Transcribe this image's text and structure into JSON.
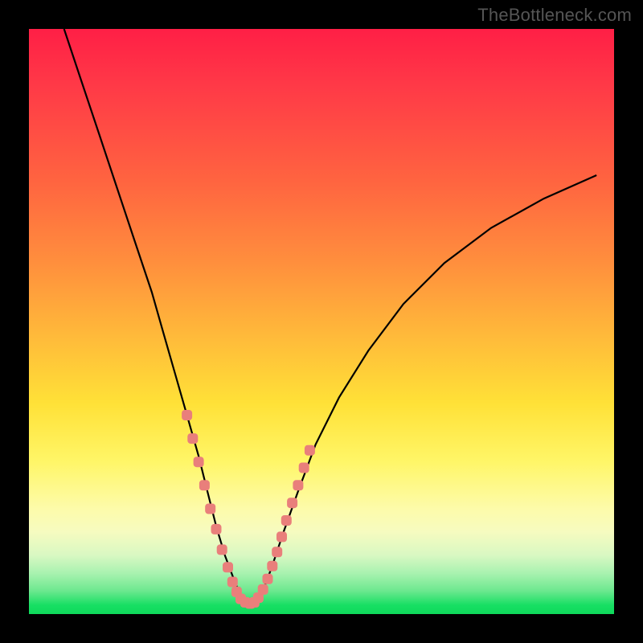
{
  "watermark": "TheBottleneck.com",
  "colors": {
    "frame": "#000000",
    "curve": "#000000",
    "marker": "#e97f7b",
    "gradient_stops": [
      "#ff1f46",
      "#ff6440",
      "#ffb83a",
      "#fff668",
      "#f6fbc0",
      "#6de88f",
      "#0fd95b"
    ]
  },
  "chart_data": {
    "type": "line",
    "title": "",
    "xlabel": "",
    "ylabel": "",
    "xlim": [
      0,
      100
    ],
    "ylim": [
      0,
      100
    ],
    "series": [
      {
        "name": "bottleneck-curve",
        "x": [
          6,
          9,
          12,
          15,
          18,
          21,
          23,
          25,
          27,
          29,
          30.5,
          32,
          33.5,
          35,
          36,
          37,
          38,
          39,
          40,
          41.5,
          43.5,
          46,
          49,
          53,
          58,
          64,
          71,
          79,
          88,
          97
        ],
        "y": [
          100,
          91,
          82,
          73,
          64,
          55,
          48,
          41,
          34,
          27,
          21,
          15,
          10,
          6,
          3.5,
          2,
          1.5,
          2,
          4,
          8,
          14,
          21,
          29,
          37,
          45,
          53,
          60,
          66,
          71,
          75
        ]
      }
    ],
    "markers": {
      "name": "highlighted-points",
      "color": "#e97f7b",
      "x": [
        27.0,
        28.0,
        29.0,
        30.0,
        31.0,
        32.0,
        33.0,
        34.0,
        34.8,
        35.5,
        36.2,
        37.0,
        37.8,
        38.5,
        39.2,
        40.0,
        40.8,
        41.6,
        42.4,
        43.2,
        44.0,
        45.0,
        46.0,
        47.0,
        48.0
      ],
      "y": [
        34.0,
        30.0,
        26.0,
        22.0,
        18.0,
        14.5,
        11.0,
        8.0,
        5.5,
        3.8,
        2.6,
        2.0,
        1.8,
        2.0,
        2.8,
        4.2,
        6.0,
        8.2,
        10.6,
        13.2,
        16.0,
        19.0,
        22.0,
        25.0,
        28.0
      ]
    }
  }
}
